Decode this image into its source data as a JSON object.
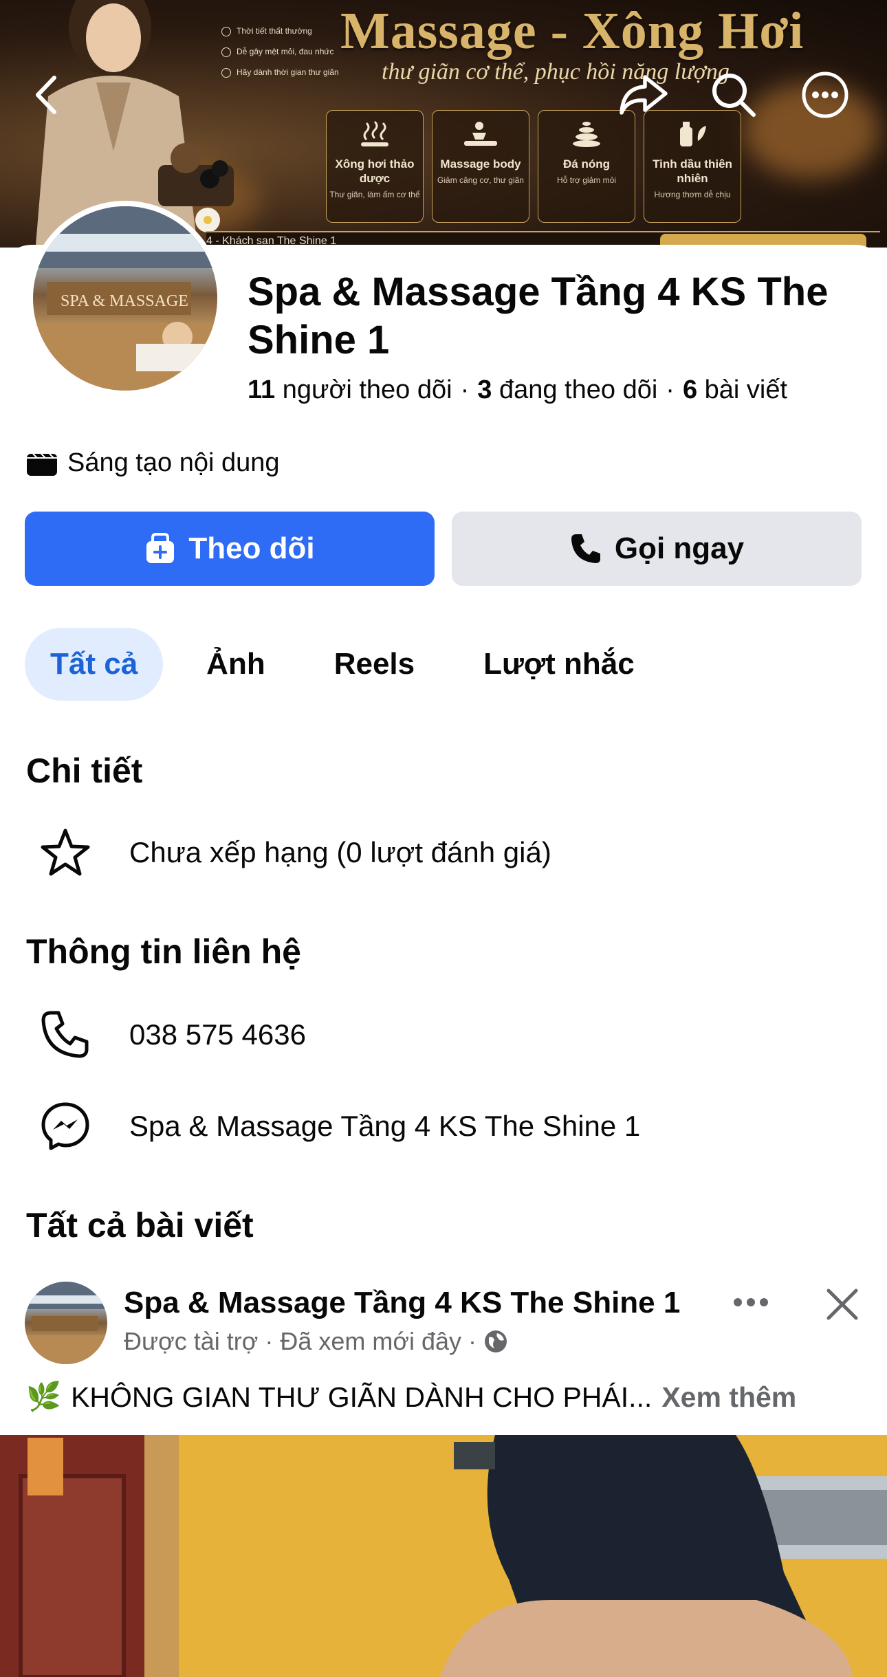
{
  "cover": {
    "title": "Massage - Xông Hơi",
    "subtitle": "thư giãn cơ thể, phục hồi năng lượng",
    "bullets": [
      "Thời tiết thất thường",
      "Dễ gây mệt mỏi, đau nhức",
      "Hãy dành thời gian thư giãn"
    ],
    "features": [
      {
        "title": "Xông hơi thảo dược",
        "desc": "Thư giãn, làm ấm cơ thể"
      },
      {
        "title": "Massage body",
        "desc": "Giảm căng cơ, thư giãn"
      },
      {
        "title": "Đá nóng",
        "desc": "Hỗ trợ giảm mỏi"
      },
      {
        "title": "Tinh dầu thiên nhiên",
        "desc": "Hương thơm dễ chịu"
      }
    ],
    "band_text": "4 - Khách sạn The Shine 1",
    "avatar_sign": "SPA & MASSAGE"
  },
  "header_icons": [
    "back-icon",
    "share-icon",
    "search-icon",
    "more-icon"
  ],
  "profile": {
    "name": "Spa & Massage Tầng 4 KS The Shine 1",
    "stats": {
      "followers_count": "11",
      "followers_label": "người theo dõi",
      "following_count": "3",
      "following_label": "đang theo dõi",
      "posts_count": "6",
      "posts_label": "bài viết",
      "separator": "·"
    },
    "category": "Sáng tạo nội dung"
  },
  "actions": {
    "follow_label": "Theo dõi",
    "call_label": "Gọi ngay"
  },
  "tabs": [
    {
      "label": "Tất cả",
      "active": true
    },
    {
      "label": "Ảnh",
      "active": false
    },
    {
      "label": "Reels",
      "active": false
    },
    {
      "label": "Lượt nhắc",
      "active": false
    }
  ],
  "details": {
    "title": "Chi tiết",
    "rating": "Chưa xếp hạng (0 lượt đánh giá)"
  },
  "contact": {
    "title": "Thông tin liên hệ",
    "phone": "038 575 4636",
    "messenger": "Spa & Massage Tầng 4 KS The Shine 1"
  },
  "posts": {
    "title": "Tất cả bài viết",
    "first": {
      "author": "Spa & Massage Tầng 4 KS The Shine 1",
      "sponsored": "Được tài trợ",
      "seen": "Đã xem mới đây",
      "separator": "·",
      "emoji": "🌿",
      "text": "KHÔNG GIAN THƯ GIÃN DÀNH CHO PHÁI...",
      "see_more": "Xem thêm"
    }
  },
  "colors": {
    "primary": "#2e6cf6",
    "secondary_button": "#e4e6eb",
    "tab_active_bg": "#e1edfe",
    "tab_active_text": "#1b63d6",
    "muted_text": "#65676b"
  }
}
